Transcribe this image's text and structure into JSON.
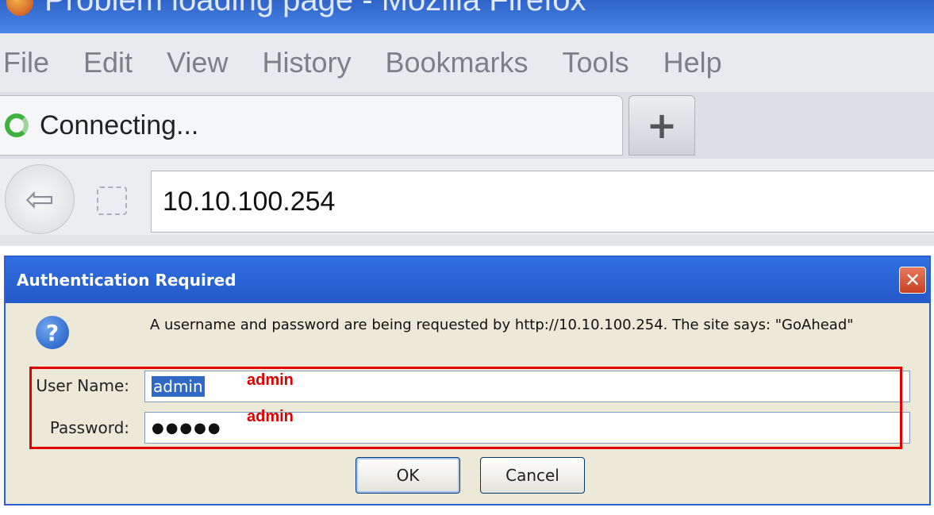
{
  "window": {
    "title": "Problem loading page - Mozilla Firefox"
  },
  "menubar": {
    "items": [
      "File",
      "Edit",
      "View",
      "History",
      "Bookmarks",
      "Tools",
      "Help"
    ]
  },
  "tabs": {
    "active_label": "Connecting...",
    "new_tab_symbol": "+"
  },
  "navbar": {
    "back_symbol": "⇦",
    "url": "10.10.100.254"
  },
  "dialog": {
    "title": "Authentication Required",
    "close_symbol": "✕",
    "help_symbol": "?",
    "message": "A username and password are being requested by http://10.10.100.254. The site says: \"GoAhead\"",
    "username_label": "User Name:",
    "username_value": "admin",
    "password_label": "Password:",
    "password_mask": "●●●●●",
    "ok_label": "OK",
    "cancel_label": "Cancel"
  },
  "annotations": {
    "username_note": "admin",
    "password_note": "admin",
    "highlight_color": "#e00000"
  }
}
